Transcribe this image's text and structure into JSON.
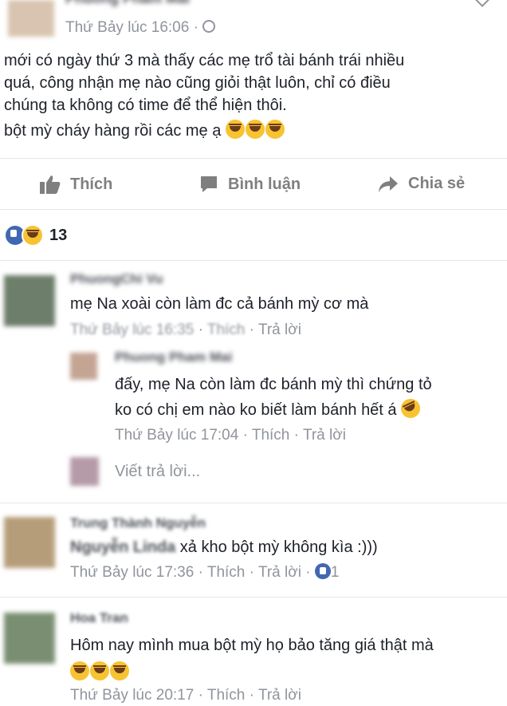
{
  "post": {
    "author": "Phuong Pham Mai",
    "timestamp": "Thứ Bảy lúc 16:06 · ",
    "text_lines": [
      "mới có ngày thứ 3 mà thấy các mẹ trổ tài bánh trái nhiều",
      "quá, công nhận mẹ nào cũng giỏi thật luôn, chỉ có điều",
      "chúng ta không có time để thể hiện thôi.",
      "bột mỳ cháy hàng rồi các mẹ ạ"
    ]
  },
  "actions": {
    "like": "Thích",
    "comment": "Bình luận",
    "share": "Chia sẻ"
  },
  "reactions": {
    "count": "13"
  },
  "comments": [
    {
      "author": "PhuongChi Vu",
      "text": "mẹ Na xoài còn làm đc cả bánh mỳ cơ mà",
      "time": "Thứ Bảy lúc 16:35",
      "like": "Thích",
      "reply": "Trả lời"
    },
    {
      "author": "Phuong Pham Mai",
      "text_lines": [
        "đấy, mẹ Na còn làm đc bánh mỳ thì chứng tỏ",
        "ko có chị em nào ko biết làm bánh hết á"
      ],
      "time": "Thứ Bảy lúc 17:04",
      "like": "Thích",
      "reply": "Trả lời"
    },
    {
      "author": "Trung Thành Nguyễn",
      "mention": "Nguyễn Linda",
      "text": " xả kho bột mỳ không kìa :)))",
      "time": "Thứ Bảy lúc 17:36",
      "like": "Thích",
      "reply": "Trả lời",
      "like_count": "1"
    },
    {
      "author": "Hoa Tran",
      "text": "Hôm nay mình mua bột mỳ họ bảo tăng giá thật mà",
      "time": "Thứ Bảy lúc 20:17",
      "like": "Thích",
      "reply": "Trả lời"
    }
  ],
  "reply_box": {
    "placeholder": "Viết trả lời..."
  },
  "colors": {
    "meta": "#90949c",
    "like_blue": "#4267b2",
    "emoji_yellow": "#f7c331"
  }
}
